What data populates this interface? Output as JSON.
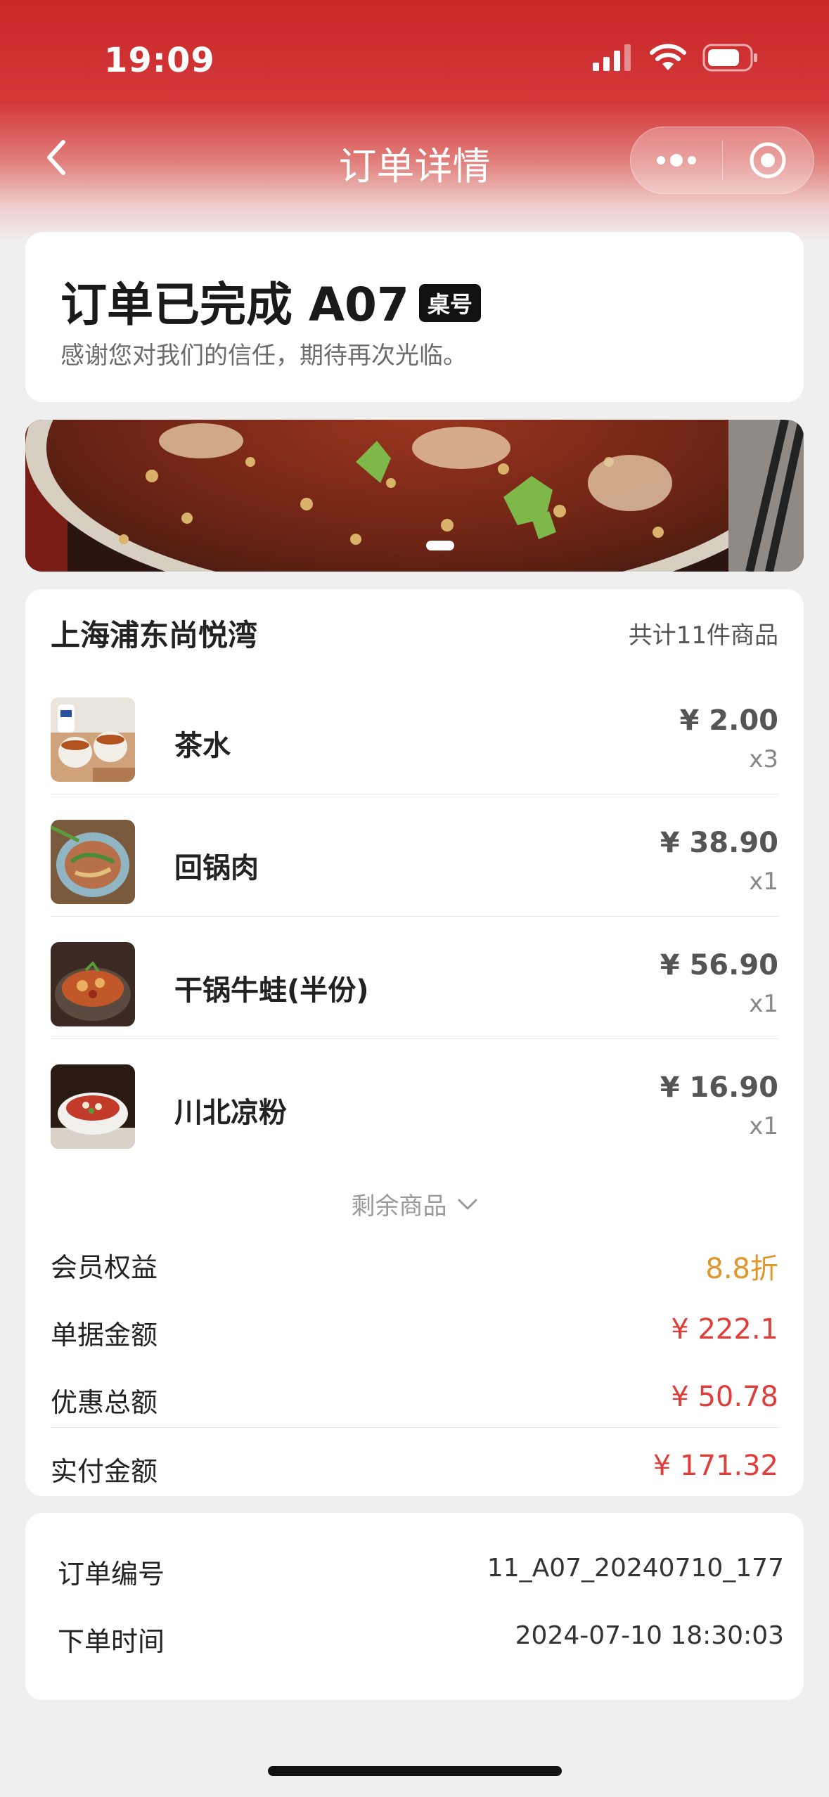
{
  "status_bar": {
    "time": "19:09"
  },
  "nav": {
    "title": "订单详情"
  },
  "order_status": {
    "title": "订单已完成 A07",
    "table_badge": "桌号",
    "subtitle": "感谢您对我们的信任，期待再次光临。"
  },
  "store": {
    "name": "上海浦东尚悦湾",
    "item_count": "共计11件商品"
  },
  "items": [
    {
      "name": "茶水",
      "price": "¥ 2.00",
      "qty": "x3"
    },
    {
      "name": "回锅肉",
      "price": "¥ 38.90",
      "qty": "x1"
    },
    {
      "name": "干锅牛蛙(半份)",
      "price": "¥ 56.90",
      "qty": "x1"
    },
    {
      "name": "川北凉粉",
      "price": "¥ 16.90",
      "qty": "x1"
    }
  ],
  "more_items_label": "剩余商品",
  "summary": {
    "member_label": "会员权益",
    "member_value": "8.8折",
    "bill_label": "单据金额",
    "bill_value": "¥ 222.1",
    "discount_label": "优惠总额",
    "discount_value": "¥ 50.78",
    "paid_label": "实付金额",
    "paid_value": "¥ 171.32"
  },
  "order_info": {
    "number_label": "订单编号",
    "number_value": "11_A07_20240710_177",
    "time_label": "下单时间",
    "time_value": "2024-07-10 18:30:03"
  },
  "colors": {
    "brand_red": "#c9272a",
    "price_red": "#e03e3a",
    "member_orange": "#e0962b"
  }
}
